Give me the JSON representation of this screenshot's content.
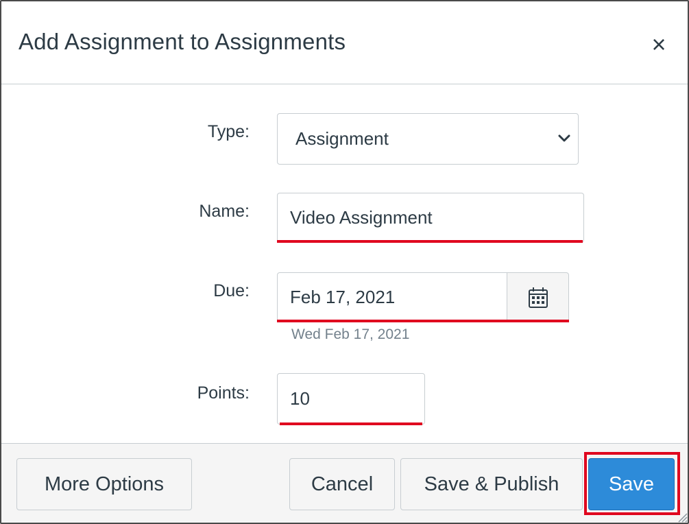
{
  "dialog": {
    "title": "Add Assignment to Assignments",
    "close_label": "×"
  },
  "form": {
    "type": {
      "label": "Type:",
      "value": "Assignment"
    },
    "name": {
      "label": "Name:",
      "value": "Video Assignment"
    },
    "due": {
      "label": "Due:",
      "value": "Feb 17, 2021",
      "hint": "Wed Feb 17, 2021",
      "calendar_icon": "calendar-icon"
    },
    "points": {
      "label": "Points:",
      "value": "10"
    }
  },
  "footer": {
    "more_options_label": "More Options",
    "cancel_label": "Cancel",
    "save_publish_label": "Save & Publish",
    "save_label": "Save"
  },
  "colors": {
    "primary": "#2d8bd9",
    "highlight": "#e0061f",
    "text": "#2d3b45",
    "muted": "#73818c"
  }
}
